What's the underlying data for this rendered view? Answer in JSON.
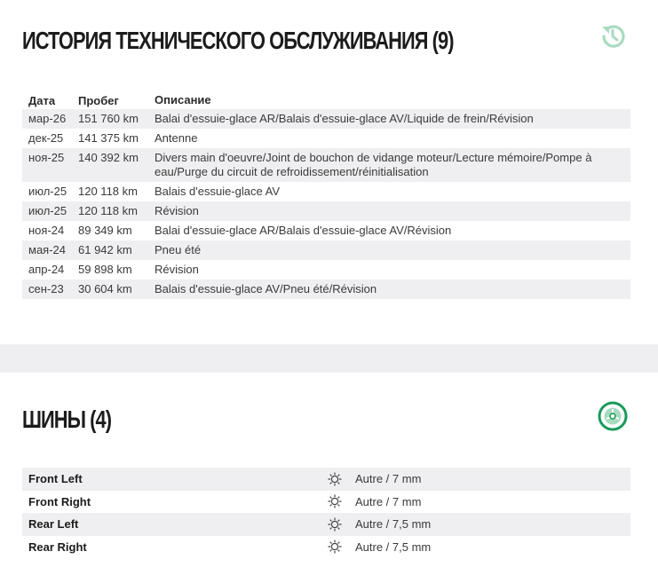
{
  "colors": {
    "accent_green": "#1a9a5a",
    "accent_light_green": "#a8dcc0",
    "row_shade": "#efeff1",
    "text_dark": "#1c1c1c"
  },
  "maintenance": {
    "title": "ИСТОРИЯ ТЕХНИЧЕСКОГО ОБСЛУЖИВАНИЯ (9)",
    "icon": "history-icon",
    "columns": {
      "date": "Дата",
      "mileage": "Пробег",
      "description": "Описание"
    },
    "rows": [
      {
        "date": "мар-26",
        "mileage": "151 760 km",
        "description": "Balai d'essuie-glace AR/Balais d'essuie-glace AV/Liquide de frein/Révision"
      },
      {
        "date": "дек-25",
        "mileage": "141 375 km",
        "description": "Antenne"
      },
      {
        "date": "ноя-25",
        "mileage": "140 392 km",
        "description": "Divers main d'oeuvre/Joint de bouchon de vidange moteur/Lecture mémoire/Pompe à eau/Purge du circuit de refroidissement/réinitialisation"
      },
      {
        "date": "июл-25",
        "mileage": "120 118 km",
        "description": "Balais d'essuie-glace AV"
      },
      {
        "date": "июл-25",
        "mileage": "120 118 km",
        "description": "Révision"
      },
      {
        "date": "ноя-24",
        "mileage": "89 349 km",
        "description": "Balai d'essuie-glace AR/Balais d'essuie-glace AV/Révision"
      },
      {
        "date": "мая-24",
        "mileage": "61 942 km",
        "description": "Pneu été"
      },
      {
        "date": "апр-24",
        "mileage": "59 898 km",
        "description": "Révision"
      },
      {
        "date": "сен-23",
        "mileage": "30 604 km",
        "description": "Balais d'essuie-glace AV/Pneu été/Révision"
      }
    ]
  },
  "tires": {
    "title": "ШИНЫ (4)",
    "icon": "tire-icon",
    "rows": [
      {
        "position": "Front Left",
        "icon": "sun-gear-icon",
        "value": "Autre / 7 mm"
      },
      {
        "position": "Front Right",
        "icon": "sun-gear-icon",
        "value": "Autre / 7 mm"
      },
      {
        "position": "Rear Left",
        "icon": "sun-gear-icon",
        "value": "Autre / 7,5 mm"
      },
      {
        "position": "Rear Right",
        "icon": "sun-gear-icon",
        "value": "Autre / 7,5 mm"
      }
    ]
  }
}
